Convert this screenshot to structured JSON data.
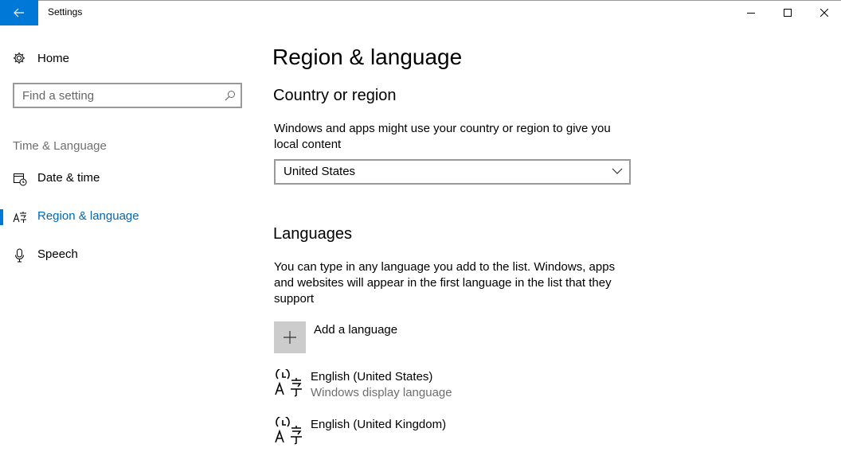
{
  "window": {
    "title": "Settings"
  },
  "sidebar": {
    "home_label": "Home",
    "search_placeholder": "Find a setting",
    "section_label": "Time & Language",
    "items": [
      {
        "label": "Date & time",
        "icon": "calendar-clock-icon"
      },
      {
        "label": "Region & language",
        "icon": "region-language-icon",
        "active": true
      },
      {
        "label": "Speech",
        "icon": "microphone-icon"
      }
    ]
  },
  "main": {
    "page_title": "Region & language",
    "country": {
      "heading": "Country or region",
      "description": "Windows and apps might use your country or region to give you local content",
      "selected": "United States"
    },
    "languages": {
      "heading": "Languages",
      "description": "You can type in any language you add to the list. Windows, apps and websites will appear in the first language in the list that they support",
      "add_label": "Add a language",
      "list": [
        {
          "name": "English (United States)",
          "subtitle": "Windows display language"
        },
        {
          "name": "English (United Kingdom)",
          "subtitle": ""
        }
      ]
    }
  },
  "colors": {
    "accent": "#0078d7",
    "active_text": "#0067b8"
  }
}
